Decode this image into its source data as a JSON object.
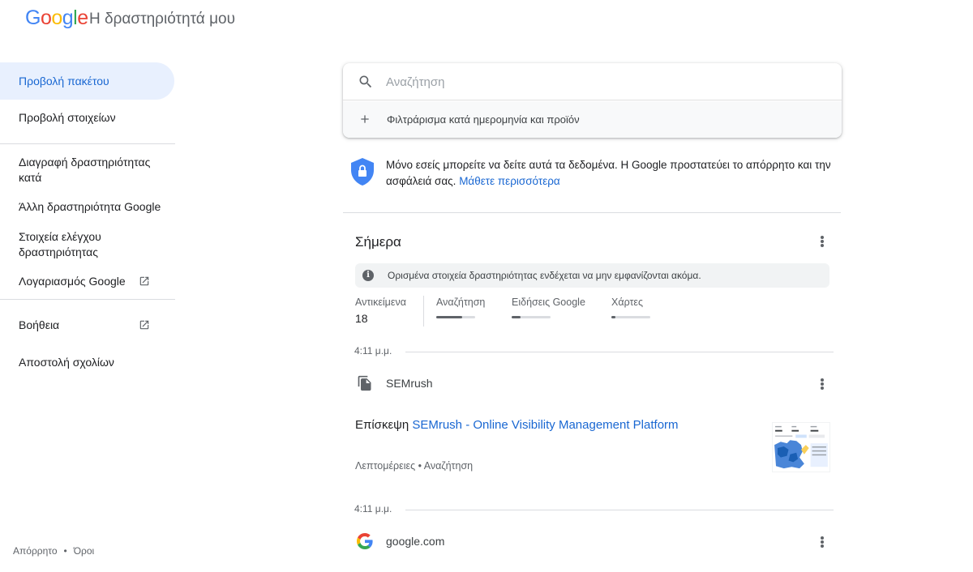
{
  "header": {
    "logo_text": "Google",
    "app_title": "Η δραστηριότητά μου"
  },
  "sidebar": {
    "items": [
      {
        "label": "Προβολή πακέτου"
      },
      {
        "label": "Προβολή στοιχείων"
      },
      {
        "label": "Διαγραφή δραστηριότητας κατά"
      },
      {
        "label": "Άλλη δραστηριότητα Google"
      },
      {
        "label": "Στοιχεία ελέγχου δραστηριότητας"
      },
      {
        "label": "Λογαριασμός Google"
      },
      {
        "label": "Βοήθεια"
      },
      {
        "label": "Αποστολή σχολίων"
      }
    ],
    "footer": {
      "privacy": "Απόρρητο",
      "dot": "•",
      "terms": "Όροι"
    }
  },
  "search": {
    "placeholder": "Αναζήτηση",
    "filter_label": "Φιλτράρισμα κατά ημερομηνία και προϊόν"
  },
  "privacy": {
    "text": "Μόνο εσείς μπορείτε να δείτε αυτά τα δεδομένα. Η Google προστατεύει το απόρρητο και την ασφάλειά σας.",
    "link": "Μάθετε περισσότερα"
  },
  "today": {
    "title": "Σήμερα",
    "notice": "Ορισμένα στοιχεία δραστηριότητας ενδέχεται να μην εμφανίζονται ακόμα.",
    "stats": {
      "items_label": "Αντικείμενα",
      "items_count": "18",
      "products": [
        {
          "label": "Αναζήτηση",
          "fraction": 0.67
        },
        {
          "label": "Ειδήσεις Google",
          "fraction": 0.22
        },
        {
          "label": "Χάρτες",
          "fraction": 0.1
        }
      ]
    },
    "entries": [
      {
        "time": "4:11 μ.μ.",
        "product": "SEMrush",
        "visit_prefix": "Επίσκεψη",
        "visit_link": "SEMrush - Online Visibility Management Platform",
        "details": "Λεπτομέρειες • Αναζήτηση"
      },
      {
        "time": "4:11 μ.μ.",
        "product": "google.com"
      }
    ]
  },
  "colors": {
    "accent": "#1967d2",
    "active_bg": "#e8f0fe",
    "shield": "#4285f4"
  }
}
